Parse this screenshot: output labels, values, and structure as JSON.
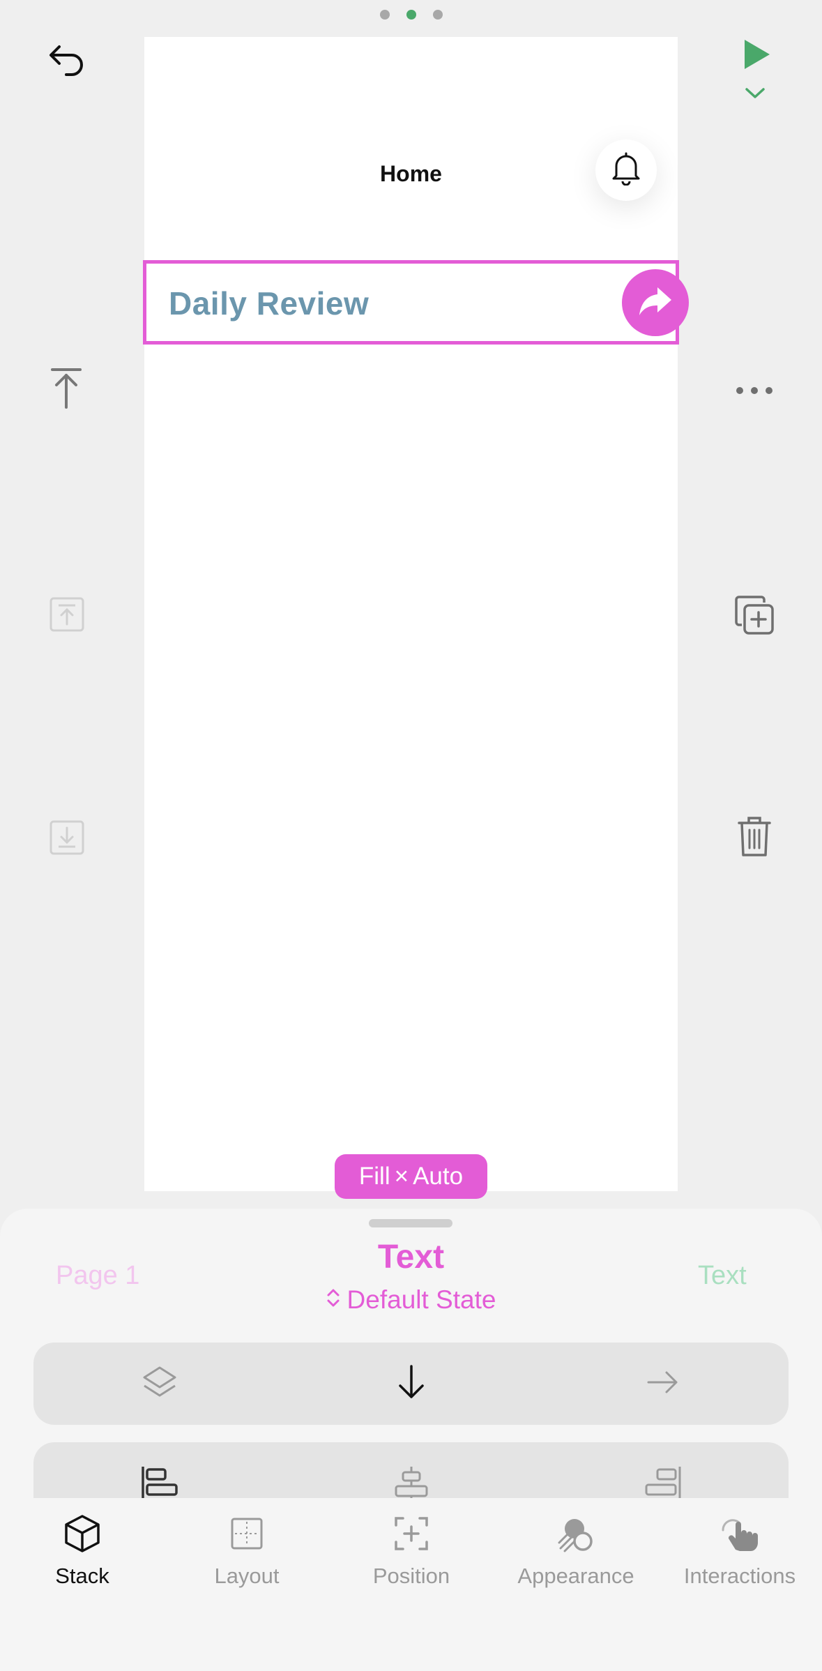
{
  "pager": {
    "count": 3,
    "active_index": 1
  },
  "canvas": {
    "nav_title": "Home",
    "selected_text": "Daily Review",
    "size_chip": {
      "width_mode": "Fill",
      "separator": "×",
      "height_mode": "Auto"
    }
  },
  "toolbar_left": [
    "undo-icon",
    "move-to-top-icon",
    "move-up-icon",
    "move-down-icon"
  ],
  "toolbar_right": [
    "play-icon",
    "chevron-down-icon",
    "more-icon",
    "duplicate-icon",
    "trash-icon"
  ],
  "sheet": {
    "prev_label": "Page 1",
    "title": "Text",
    "state_label": "Default State",
    "next_label": "Text",
    "direction_options": [
      "layers-icon",
      "arrow-down-icon",
      "arrow-right-icon"
    ],
    "selected_direction": "arrow-down-icon",
    "alignment_options": [
      "align-left-icon",
      "align-center-icon",
      "align-right-icon"
    ]
  },
  "tabs": [
    {
      "label": "Stack",
      "icon": "cube-icon",
      "active": true
    },
    {
      "label": "Layout",
      "icon": "layout-grid-icon",
      "active": false
    },
    {
      "label": "Position",
      "icon": "position-icon",
      "active": false
    },
    {
      "label": "Appearance",
      "icon": "appearance-icon",
      "active": false
    },
    {
      "label": "Interactions",
      "icon": "hand-pointer-icon",
      "active": false
    }
  ],
  "colors": {
    "accent": "#e35cd6",
    "play_green": "#4aa86a",
    "title_blue": "#6b96ad",
    "background": "#efefef"
  }
}
